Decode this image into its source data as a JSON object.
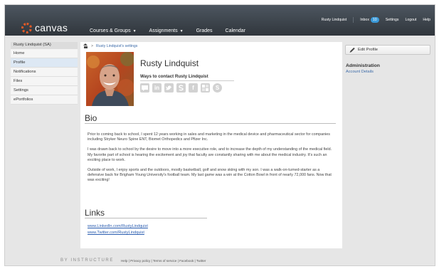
{
  "header": {
    "logo_text": "canvas",
    "nav": [
      {
        "label": "Courses & Groups",
        "has_caret": true
      },
      {
        "label": "Assignments",
        "has_caret": true
      },
      {
        "label": "Grades",
        "has_caret": false
      },
      {
        "label": "Calendar",
        "has_caret": false
      }
    ],
    "user_name": "Rusty Lindquist",
    "inbox_label": "Inbox",
    "inbox_count": "10",
    "settings_label": "Settings",
    "logout_label": "Logout",
    "help_label": "Help",
    "accent_color": "#e45a26",
    "badge_color": "#3b9ad9"
  },
  "sidebar": {
    "title": "Rusty Lindquist (SA)",
    "items": [
      {
        "label": "Home",
        "active": false
      },
      {
        "label": "Profile",
        "active": true
      },
      {
        "label": "Notifications",
        "active": false
      },
      {
        "label": "Files",
        "active": false
      },
      {
        "label": "Settings",
        "active": false
      },
      {
        "label": "ePortfolios",
        "active": false
      }
    ]
  },
  "breadcrumb": {
    "home_icon": "home-icon",
    "separator": ">",
    "current": "Rusty Lindquist's settings"
  },
  "profile": {
    "name": "Rusty Lindquist",
    "ways_to_contact": "Ways to contact Rusty Lindquist",
    "contact_icons": [
      "chat-icon",
      "linkedin-icon",
      "twitter-icon",
      "skype-icon",
      "facebook-icon",
      "delicious-icon",
      "skype-alt-icon"
    ]
  },
  "bio": {
    "heading": "Bio",
    "paragraphs": [
      "Prior to coming back to school, I spent 12 years working in sales and marketing in the medical device and pharmaceutical sector for companies including Stryker Neuro Spine ENT, Biomet Orthopedics and Pfizer Inc.",
      "I was drawn back to school by the desire to move into a more executive role, and to increase the depth of my understanding of the medical field. My favorite part of school is hearing the excitement and joy that faculty are constantly sharing with me about the medical industry. It's such an exciting place to work.",
      "Outside of work, I enjoy sports and the outdoors, mostly basketball, golf and snow skiing with my son. I was a walk-on-turned-starter as a defensive back for Brigham Young University's football team. My last game was a win at the Cotton Bowl in front of nearly 72,000 fans. Now that was exciting!"
    ]
  },
  "links": {
    "heading": "Links",
    "items": [
      "www.LinkedIn.com/RustyLindquist",
      "www.Twitter.com/RustyLindquist"
    ]
  },
  "right_panel": {
    "edit_button": "Edit Profile",
    "admin_heading": "Administration",
    "admin_link": "Account Details"
  },
  "footer": {
    "brand": "BY INSTRUCTURE",
    "links": "Help | Privacy policy | Terms of service | Facebook | Twitter"
  }
}
